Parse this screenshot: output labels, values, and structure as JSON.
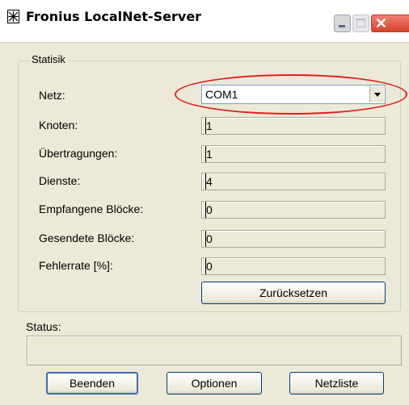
{
  "window": {
    "title": "Fronius LocalNet-Server",
    "icon": "app-grid-icon",
    "controls": [
      "minimize-icon",
      "maximize-icon",
      "close-icon"
    ]
  },
  "stats": {
    "legend": "Statisik",
    "netz_label": "Netz:",
    "netz_value": "COM1",
    "rows": [
      {
        "label": "Knoten:",
        "value": "1"
      },
      {
        "label": "Übertragungen:",
        "value": "1"
      },
      {
        "label": "Dienste:",
        "value": "4"
      },
      {
        "label": "Empfangene Blöcke:",
        "value": "0"
      },
      {
        "label": "Gesendete Blöcke:",
        "value": "0"
      },
      {
        "label": "Fehlerrate [%]:",
        "value": "0"
      }
    ],
    "reset_button": "Zurücksetzen"
  },
  "status": {
    "label": "Status:",
    "value": ""
  },
  "footer": {
    "exit_button": "Beenden",
    "options_button": "Optionen",
    "netlist_button": "Netzliste"
  },
  "colors": {
    "window_bg": "#ece9d8",
    "highlight": "#e02020",
    "close_button": "#d6452e"
  }
}
